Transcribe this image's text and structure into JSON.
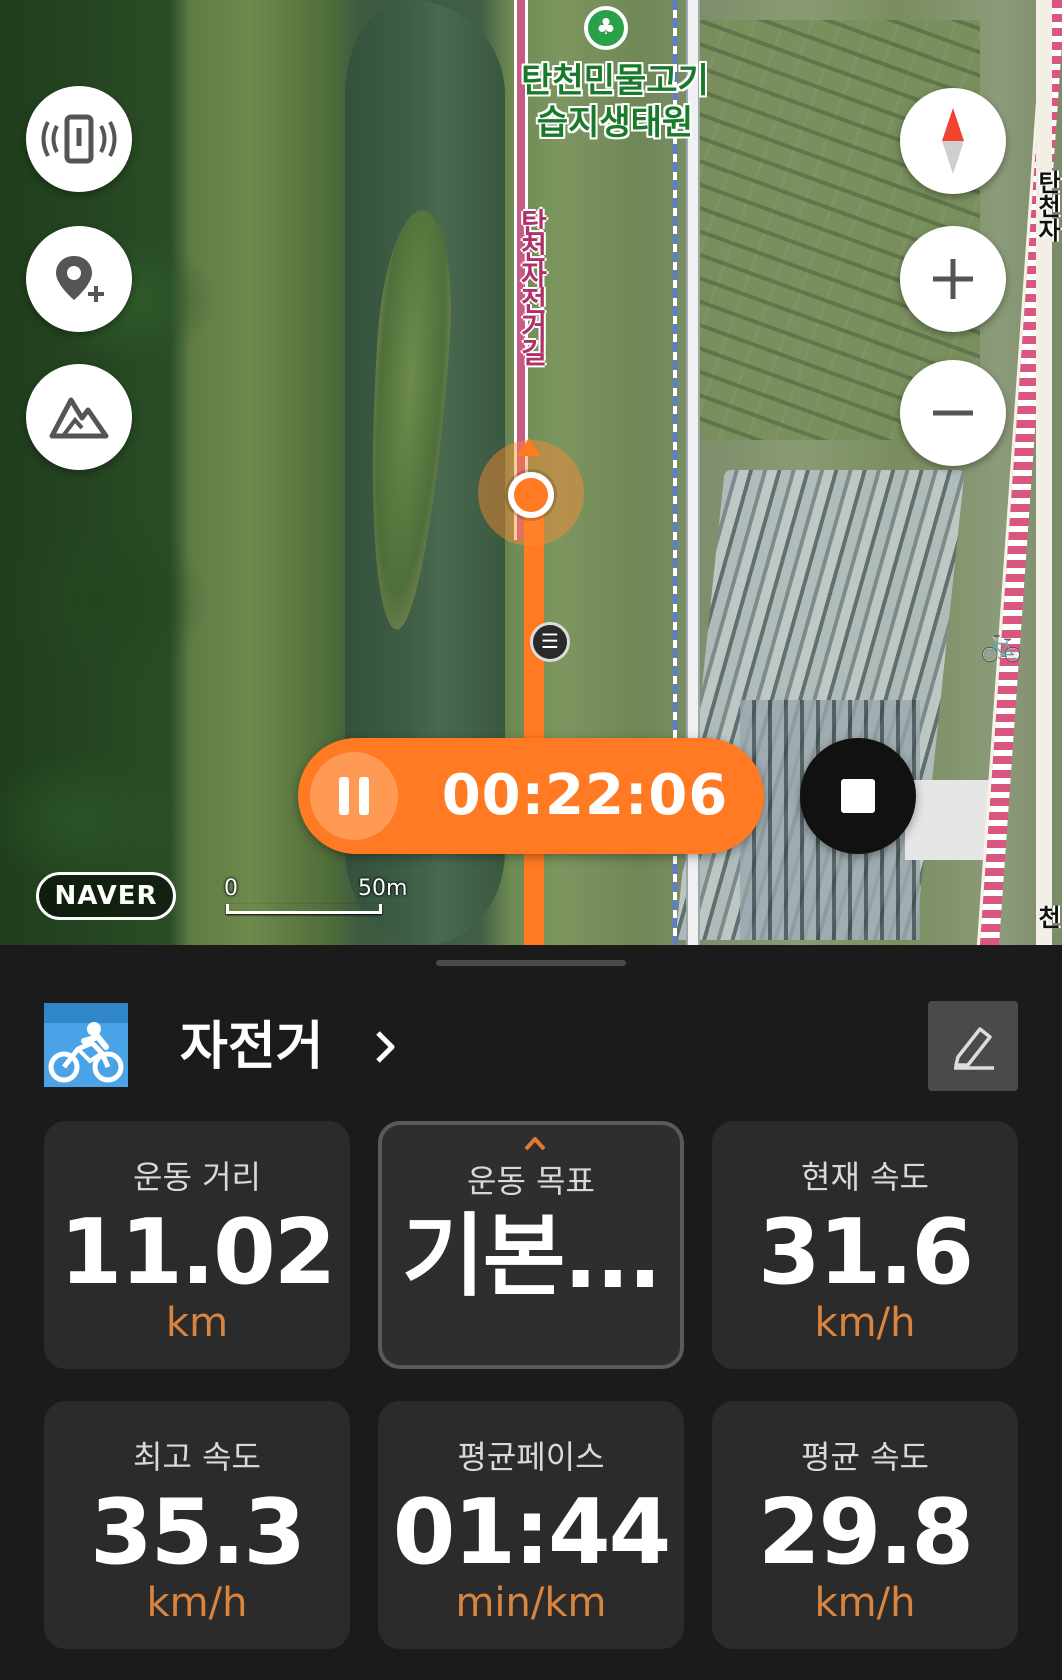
{
  "map": {
    "poi_label": "탄천민물고기\n습지생태원",
    "road_label": "탄천자전거길",
    "road_label_right_top": "탄천자",
    "road_label_right_bottom": "탄천",
    "naver_logo": "NAVER",
    "scale_start": "0",
    "scale_end": "50m",
    "buttons": {
      "vibrate_icon": "phone-vibrate-icon",
      "add_location_icon": "add-location-icon",
      "terrain_icon": "mountain-icon",
      "compass_icon": "compass-icon",
      "zoom_in_icon": "plus-icon",
      "zoom_out_icon": "minus-icon"
    },
    "colors": {
      "route": "#ff7a22",
      "bike_road": "#c85a86",
      "poi_green": "#2aa04a"
    }
  },
  "workout": {
    "timer": "00:22:06",
    "pause_icon": "pause-icon",
    "stop_icon": "stop-icon"
  },
  "panel": {
    "activity": "자전거",
    "activity_icon": "cycling-icon",
    "edit_icon": "pencil-icon",
    "stats": [
      {
        "label": "운동 거리",
        "value": "11.02",
        "unit": "km"
      },
      {
        "label": "운동 목표",
        "value": "기본...",
        "unit": ""
      },
      {
        "label": "현재 속도",
        "value": "31.6",
        "unit": "km/h"
      },
      {
        "label": "최고 속도",
        "value": "35.3",
        "unit": "km/h"
      },
      {
        "label": "평균페이스",
        "value": "01:44",
        "unit": "min/km"
      },
      {
        "label": "평균 속도",
        "value": "29.8",
        "unit": "km/h"
      }
    ],
    "accent_color": "#d9843f"
  }
}
